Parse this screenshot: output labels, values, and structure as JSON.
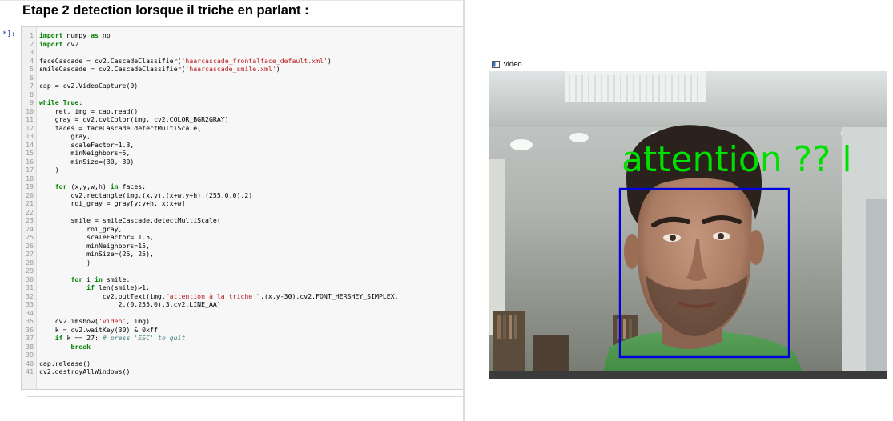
{
  "notebook": {
    "heading": "Etape 2 detection lorsque il triche en parlant :",
    "prompt": "*]:",
    "code_lines": [
      "import numpy as np",
      "import cv2",
      "",
      "faceCascade = cv2.CascadeClassifier('haarcascade_frontalface_default.xml')",
      "smileCascade = cv2.CascadeClassifier('haarcascade_smile.xml')",
      "",
      "cap = cv2.VideoCapture(0)",
      "",
      "while True:",
      "    ret, img = cap.read()",
      "    gray = cv2.cvtColor(img, cv2.COLOR_BGR2GRAY)",
      "    faces = faceCascade.detectMultiScale(",
      "        gray,",
      "        scaleFactor=1.3,",
      "        minNeighbors=5,",
      "        minSize=(30, 30)",
      "    )",
      "",
      "    for (x,y,w,h) in faces:",
      "        cv2.rectangle(img,(x,y),(x+w,y+h),(255,0,0),2)",
      "        roi_gray = gray[y:y+h, x:x+w]",
      "",
      "        smile = smileCascade.detectMultiScale(",
      "            roi_gray,",
      "            scaleFactor= 1.5,",
      "            minNeighbors=15,",
      "            minSize=(25, 25),",
      "            )",
      "",
      "        for i in smile:",
      "            if len(smile)>1:",
      "                cv2.putText(img,\"attention à la triche \",(x,y-30),cv2.FONT_HERSHEY_SIMPLEX,",
      "                    2,(0,255,0),3,cv2.LINE_AA)",
      "",
      "    cv2.imshow('video', img)",
      "    k = cv2.waitKey(30) & 0xff",
      "    if k == 27: # press 'ESC' to quit",
      "        break",
      "",
      "cap.release()",
      "cv2.destroyAllWindows()"
    ]
  },
  "video_window": {
    "title": "video",
    "overlay_text": "attention ?? l",
    "overlay_color": "#00e000",
    "face_box_color": "#0000dd"
  },
  "colors": {
    "keyword": "#008000",
    "string": "#ba2121",
    "comment": "#408080",
    "prompt": "#303f9f"
  }
}
